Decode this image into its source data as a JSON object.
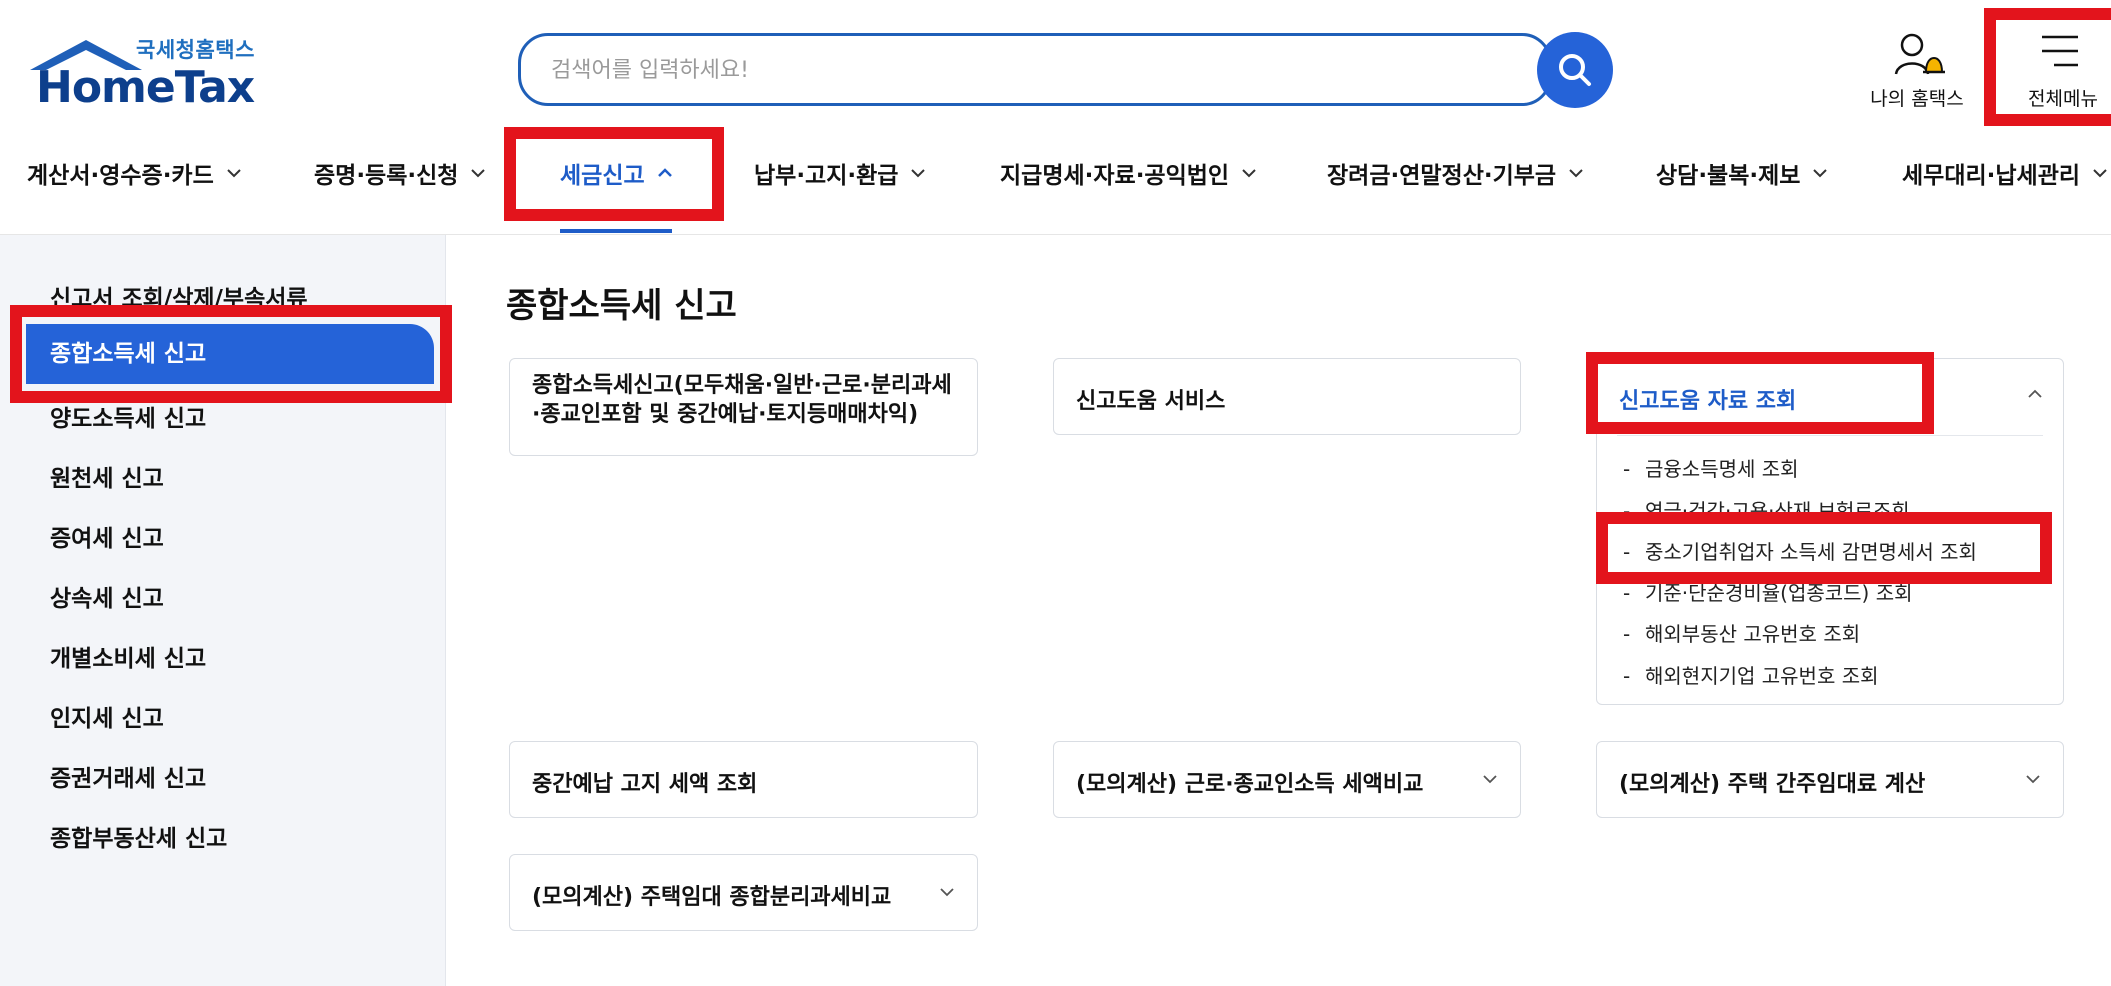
{
  "logo": {
    "sub": "국세청홈택스",
    "main": "HomeTax"
  },
  "search": {
    "placeholder": "검색어를 입력하세요!"
  },
  "utility": {
    "my_hometax": "나의 홈택스",
    "all_menu": "전체메뉴"
  },
  "gnb": [
    "계산서·영수증·카드",
    "증명·등록·신청",
    "세금신고",
    "납부·고지·환급",
    "지급명세·자료·공익법인",
    "장려금·연말정산·기부금",
    "상담·불복·제보",
    "세무대리·납세관리"
  ],
  "gnb_active_index": 2,
  "lnb": [
    "신고서 조회/삭제/부속서류",
    "종합소득세 신고",
    "양도소득세 신고",
    "원천세 신고",
    "증여세 신고",
    "상속세 신고",
    "개별소비세 신고",
    "인지세 신고",
    "증권거래세 신고",
    "종합부동산세 신고"
  ],
  "lnb_active_index": 1,
  "page_title": "종합소득세 신고",
  "cards": {
    "c1": "종합소득세신고(모두채움·일반·근로·분리과세·종교인포함 및 중간예납·토지등매매차익)",
    "c2": "신고도움 서비스",
    "c3": "신고도움 자료 조회",
    "c4": "중간예납 고지 세액 조회",
    "c5": "(모의계산) 근로·종교인소득 세액비교",
    "c6": "(모의계산) 주택 간주임대료 계산",
    "c7": "(모의계산) 주택임대 종합분리과세비교"
  },
  "c3_sub_items": [
    "금융소득명세 조회",
    "연금·건강·고용·산재 보험료조회",
    "중소기업취업자 소득세 감면명세서 조회",
    "기준·단순경비율(업종코드) 조회",
    "해외부동산 고유번호 조회",
    "해외현지기업 고유번호 조회"
  ],
  "colors": {
    "primary": "#1e5cc8",
    "button_blue": "#2563d8",
    "logo_navy": "#0d3f8c",
    "highlight_red": "#e3141c",
    "lnb_bg": "#f3f5f9"
  },
  "icons": [
    "house-roof-icon",
    "search-icon",
    "user-bell-icon",
    "hamburger-icon",
    "chevron-down-icon",
    "chevron-up-icon"
  ]
}
